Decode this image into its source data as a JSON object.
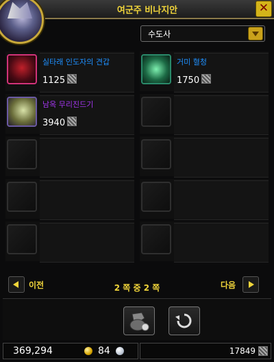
{
  "window": {
    "title": "여군주 비나지안"
  },
  "filter": {
    "selected": "수도사"
  },
  "items": [
    {
      "name": "실타래 인도자의 견갑",
      "price": "1125",
      "name_color": "#1e90ff",
      "icon": "pauldron-icon"
    },
    {
      "name": "거미 혈청",
      "price": "1750",
      "name_color": "#1e90ff",
      "icon": "serum-icon"
    },
    {
      "name": "남옥 무리진드기",
      "price": "3940",
      "name_color": "#a335ee",
      "icon": "mount-icon"
    }
  ],
  "nav": {
    "prev_label": "이전",
    "next_label": "다음",
    "page_info": "2 쪽 중 2 쪽"
  },
  "currency": {
    "gold": "369,294",
    "silver": "84",
    "tokens": "17849"
  },
  "colors": {
    "accent": "#f1d53a",
    "rare": "#1e90ff",
    "epic": "#a335ee"
  }
}
